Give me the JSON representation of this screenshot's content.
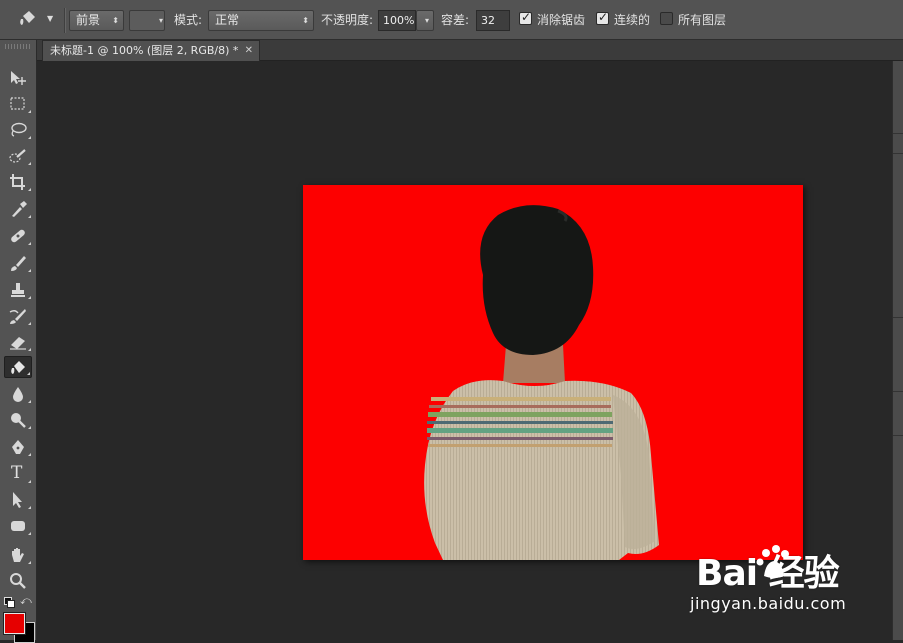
{
  "options_bar": {
    "fill_source": "前景",
    "mode_label": "模式:",
    "mode_value": "正常",
    "opacity_label": "不透明度:",
    "opacity_value": "100%",
    "tolerance_label": "容差:",
    "tolerance_value": "32",
    "anti_alias_label": "消除锯齿",
    "anti_alias_checked": true,
    "contiguous_label": "连续的",
    "contiguous_checked": true,
    "all_layers_label": "所有图层",
    "all_layers_checked": false
  },
  "document": {
    "tab_title": "未标题-1 @ 100% (图层 2, RGB/8) *",
    "background_color": "#fd0000"
  },
  "tools": {
    "active": "paint-bucket-icon",
    "foreground_color": "#e60000",
    "background_color": "#000000",
    "text_tool_glyph": "T"
  },
  "watermark": {
    "logo": "Bai  经验",
    "url": "jingyan.baidu.com"
  }
}
